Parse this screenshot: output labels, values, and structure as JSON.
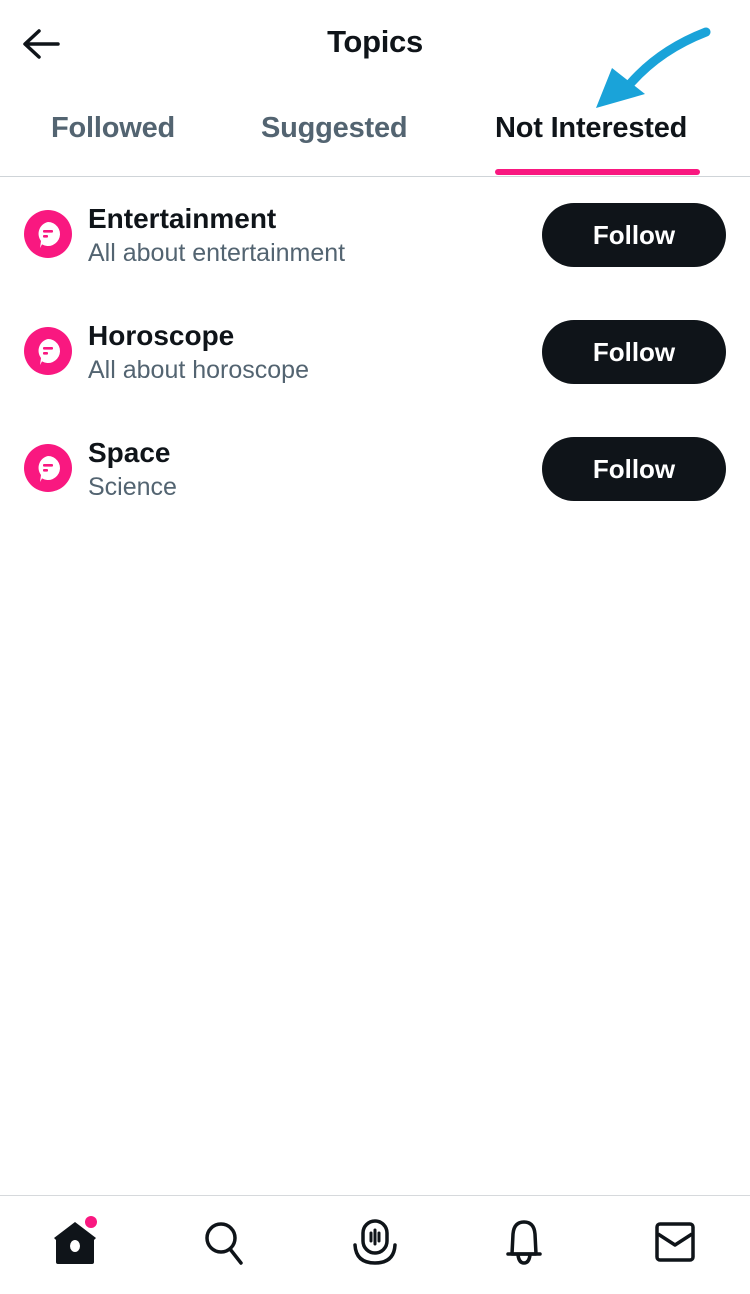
{
  "header": {
    "title": "Topics",
    "back_icon": "arrow-left-icon"
  },
  "tabs": [
    {
      "label": "Followed",
      "active": false
    },
    {
      "label": "Suggested",
      "active": false
    },
    {
      "label": "Not Interested",
      "active": true
    }
  ],
  "annotation": {
    "icon": "pointer-arrow-icon",
    "color": "#1aa3d9"
  },
  "topics": [
    {
      "name": "Entertainment",
      "subtitle": "All about entertainment",
      "button": "Follow",
      "icon": "topic-bubble-icon"
    },
    {
      "name": "Horoscope",
      "subtitle": "All about horoscope",
      "button": "Follow",
      "icon": "topic-bubble-icon"
    },
    {
      "name": "Space",
      "subtitle": "Science",
      "button": "Follow",
      "icon": "topic-bubble-icon"
    }
  ],
  "bottom_nav": [
    {
      "icon": "home-icon",
      "active": true,
      "has_notification_dot": true
    },
    {
      "icon": "search-icon",
      "active": false
    },
    {
      "icon": "spaces-icon",
      "active": false
    },
    {
      "icon": "bell-icon",
      "active": false
    },
    {
      "icon": "mail-icon",
      "active": false
    }
  ],
  "colors": {
    "accent": "#f91880",
    "text_primary": "#0f1419",
    "text_secondary": "#536471",
    "button_bg": "#0f1419",
    "annotation_arrow": "#1aa3d9"
  }
}
